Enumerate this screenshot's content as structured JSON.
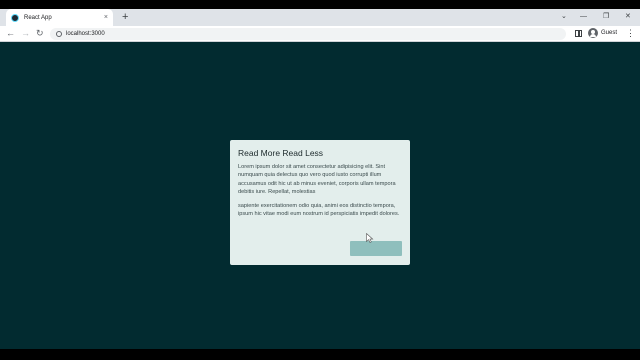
{
  "browser": {
    "tab": {
      "title": "React App",
      "close_glyph": "×"
    },
    "new_tab_glyph": "+",
    "window_controls": {
      "minimize": "—",
      "restore": "❐",
      "close": "✕",
      "dropdown": "⌄"
    },
    "nav": {
      "back": "←",
      "forward": "→",
      "reload": "↻"
    },
    "address": {
      "url": "localhost:3000"
    },
    "profile": {
      "label": "Guest"
    },
    "menu_glyph": "⋮"
  },
  "card": {
    "title": "Read More Read Less",
    "paragraph1": "Lorem ipsum dolor sit amet consectetur adipisicing elit. Sint numquam quia delectus quo vero quod iusto corrupti illum accusamus odit hic ut ab minus eveniet, corporis ullam tempora debitis iure. Repellat, molestias",
    "paragraph2": "sapiente exercitationem odio quia, animi eos distinctio tempora, ipsum hic vitae modi eum nostrum id perspiciatis impedit dolores.",
    "button_label": ""
  },
  "colors": {
    "page_background": "#022b30",
    "card_background": "#e3eeec",
    "button_background": "#8fbfbd",
    "tabstrip": "#dfe3e8"
  }
}
